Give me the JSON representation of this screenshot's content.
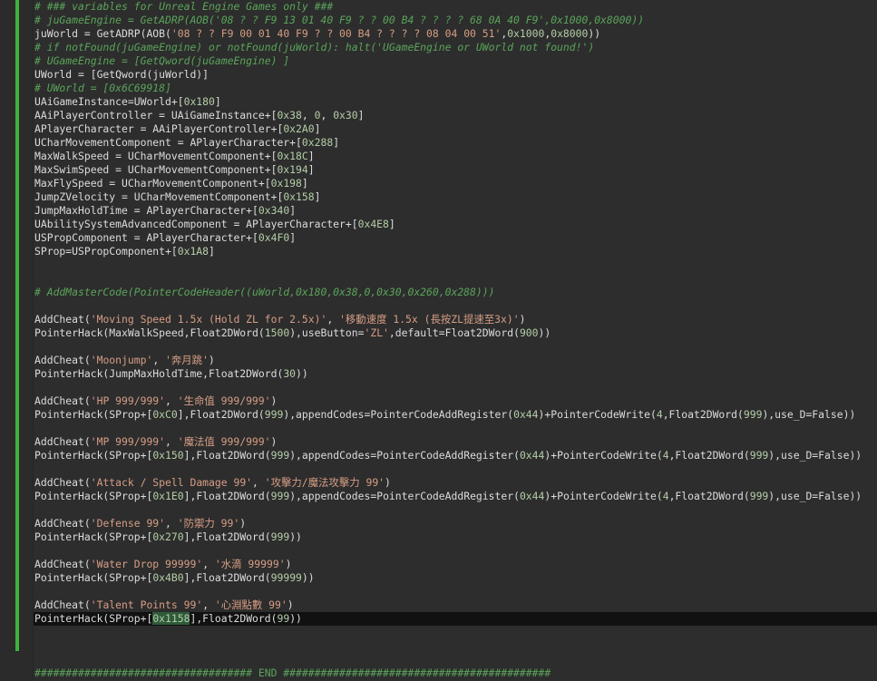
{
  "editor": {
    "colors": {
      "background": "#2d2d2d",
      "gutter": "#2b2b2b",
      "change_bar": "#3db33d",
      "current_line": "#111111",
      "comment": "#5aa45a",
      "string": "#d69d85",
      "number": "#b5cea8",
      "text": "#dcdcdc"
    },
    "current_line_index": 45,
    "lines": [
      [
        [
          "c",
          "# ### variables for Unreal Engine Games only ###"
        ]
      ],
      [
        [
          "c",
          "# juGameEngine = GetADRP(AOB('08 ? ? F9 13 01 40 F9 ? ? 00 B4 ? ? ? ? 68 0A 40 F9',0x1000,0x8000))"
        ]
      ],
      [
        [
          "t",
          "juWorld = GetADRP(AOB("
        ],
        [
          "s",
          "'08 ? ? F9 00 01 40 F9 ? ? 00 B4 ? ? ? ? 08 04 00 51'"
        ],
        [
          "t",
          ","
        ],
        [
          "n",
          "0x1000"
        ],
        [
          "t",
          ","
        ],
        [
          "n",
          "0x8000"
        ],
        [
          "t",
          "))"
        ]
      ],
      [
        [
          "c",
          "# if notFound(juGameEngine) or notFound(juWorld): halt('UGameEngine or UWorld not found!')"
        ]
      ],
      [
        [
          "c",
          "# UGameEngine = [GetQword(juGameEngine) ]"
        ]
      ],
      [
        [
          "t",
          "UWorld = [GetQword(juWorld)]"
        ]
      ],
      [
        [
          "c",
          "# UWorld = [0x6C69918]"
        ]
      ],
      [
        [
          "t",
          "UAiGameInstance=UWorld+["
        ],
        [
          "n",
          "0x180"
        ],
        [
          "t",
          "]"
        ]
      ],
      [
        [
          "t",
          "AAiPlayerController = UAiGameInstance+["
        ],
        [
          "n",
          "0x38"
        ],
        [
          "t",
          ", "
        ],
        [
          "n",
          "0"
        ],
        [
          "t",
          ", "
        ],
        [
          "n",
          "0x30"
        ],
        [
          "t",
          "]"
        ]
      ],
      [
        [
          "t",
          "APlayerCharacter = AAiPlayerController+["
        ],
        [
          "n",
          "0x2A0"
        ],
        [
          "t",
          "]"
        ]
      ],
      [
        [
          "t",
          "UCharMovementComponent = APlayerCharacter+["
        ],
        [
          "n",
          "0x288"
        ],
        [
          "t",
          "]"
        ]
      ],
      [
        [
          "t",
          "MaxWalkSpeed = UCharMovementComponent+["
        ],
        [
          "n",
          "0x18C"
        ],
        [
          "t",
          "]"
        ]
      ],
      [
        [
          "t",
          "MaxSwimSpeed = UCharMovementComponent+["
        ],
        [
          "n",
          "0x194"
        ],
        [
          "t",
          "]"
        ]
      ],
      [
        [
          "t",
          "MaxFlySpeed = UCharMovementComponent+["
        ],
        [
          "n",
          "0x198"
        ],
        [
          "t",
          "]"
        ]
      ],
      [
        [
          "t",
          "JumpZVelocity = UCharMovementComponent+["
        ],
        [
          "n",
          "0x158"
        ],
        [
          "t",
          "]"
        ]
      ],
      [
        [
          "t",
          "JumpMaxHoldTime = APlayerCharacter+["
        ],
        [
          "n",
          "0x340"
        ],
        [
          "t",
          "]"
        ]
      ],
      [
        [
          "t",
          "UAbilitySystemAdvancedComponent = APlayerCharacter+["
        ],
        [
          "n",
          "0x4E8"
        ],
        [
          "t",
          "]"
        ]
      ],
      [
        [
          "t",
          "USPropComponent = APlayerCharacter+["
        ],
        [
          "n",
          "0x4F0"
        ],
        [
          "t",
          "]"
        ]
      ],
      [
        [
          "t",
          "SProp=USPropComponent+["
        ],
        [
          "n",
          "0x1A8"
        ],
        [
          "t",
          "]"
        ]
      ],
      [],
      [],
      [
        [
          "c",
          "# AddMasterCode(PointerCodeHeader((uWorld,0x180,0x38,0,0x30,0x260,0x288)))"
        ]
      ],
      [],
      [
        [
          "t",
          "AddCheat("
        ],
        [
          "s",
          "'Moving Speed 1.5x (Hold ZL for 2.5x)'"
        ],
        [
          "t",
          ", "
        ],
        [
          "s",
          "'移動速度 1.5x (長按ZL提速至3x)'"
        ],
        [
          "t",
          ")"
        ]
      ],
      [
        [
          "t",
          "PointerHack(MaxWalkSpeed,Float2DWord("
        ],
        [
          "n",
          "1500"
        ],
        [
          "t",
          "),useButton="
        ],
        [
          "s",
          "'ZL'"
        ],
        [
          "t",
          ",default=Float2DWord("
        ],
        [
          "n",
          "900"
        ],
        [
          "t",
          "))"
        ]
      ],
      [],
      [
        [
          "t",
          "AddCheat("
        ],
        [
          "s",
          "'Moonjump'"
        ],
        [
          "t",
          ", "
        ],
        [
          "s",
          "'奔月跳'"
        ],
        [
          "t",
          ")"
        ]
      ],
      [
        [
          "t",
          "PointerHack(JumpMaxHoldTime,Float2DWord("
        ],
        [
          "n",
          "30"
        ],
        [
          "t",
          "))"
        ]
      ],
      [],
      [
        [
          "t",
          "AddCheat("
        ],
        [
          "s",
          "'HP 999/999'"
        ],
        [
          "t",
          ", "
        ],
        [
          "s",
          "'生命值 999/999'"
        ],
        [
          "t",
          ")"
        ]
      ],
      [
        [
          "t",
          "PointerHack(SProp+["
        ],
        [
          "n",
          "0xC0"
        ],
        [
          "t",
          "],Float2DWord("
        ],
        [
          "n",
          "999"
        ],
        [
          "t",
          "),appendCodes=PointerCodeAddRegister("
        ],
        [
          "n",
          "0x44"
        ],
        [
          "t",
          ")+PointerCodeWrite("
        ],
        [
          "n",
          "4"
        ],
        [
          "t",
          ",Float2DWord("
        ],
        [
          "n",
          "999"
        ],
        [
          "t",
          "),use_D=False))"
        ]
      ],
      [],
      [
        [
          "t",
          "AddCheat("
        ],
        [
          "s",
          "'MP 999/999'"
        ],
        [
          "t",
          ", "
        ],
        [
          "s",
          "'魔法值 999/999'"
        ],
        [
          "t",
          ")"
        ]
      ],
      [
        [
          "t",
          "PointerHack(SProp+["
        ],
        [
          "n",
          "0x150"
        ],
        [
          "t",
          "],Float2DWord("
        ],
        [
          "n",
          "999"
        ],
        [
          "t",
          "),appendCodes=PointerCodeAddRegister("
        ],
        [
          "n",
          "0x44"
        ],
        [
          "t",
          ")+PointerCodeWrite("
        ],
        [
          "n",
          "4"
        ],
        [
          "t",
          ",Float2DWord("
        ],
        [
          "n",
          "999"
        ],
        [
          "t",
          "),use_D=False))"
        ]
      ],
      [],
      [
        [
          "t",
          "AddCheat("
        ],
        [
          "s",
          "'Attack / Spell Damage 99'"
        ],
        [
          "t",
          ", "
        ],
        [
          "s",
          "'攻擊力/魔法攻擊力 99'"
        ],
        [
          "t",
          ")"
        ]
      ],
      [
        [
          "t",
          "PointerHack(SProp+["
        ],
        [
          "n",
          "0x1E0"
        ],
        [
          "t",
          "],Float2DWord("
        ],
        [
          "n",
          "999"
        ],
        [
          "t",
          "),appendCodes=PointerCodeAddRegister("
        ],
        [
          "n",
          "0x44"
        ],
        [
          "t",
          ")+PointerCodeWrite("
        ],
        [
          "n",
          "4"
        ],
        [
          "t",
          ",Float2DWord("
        ],
        [
          "n",
          "999"
        ],
        [
          "t",
          "),use_D=False))"
        ]
      ],
      [],
      [
        [
          "t",
          "AddCheat("
        ],
        [
          "s",
          "'Defense 99'"
        ],
        [
          "t",
          ", "
        ],
        [
          "s",
          "'防禦力 99'"
        ],
        [
          "t",
          ")"
        ]
      ],
      [
        [
          "t",
          "PointerHack(SProp+["
        ],
        [
          "n",
          "0x270"
        ],
        [
          "t",
          "],Float2DWord("
        ],
        [
          "n",
          "999"
        ],
        [
          "t",
          "))"
        ]
      ],
      [],
      [
        [
          "t",
          "AddCheat("
        ],
        [
          "s",
          "'Water Drop 99999'"
        ],
        [
          "t",
          ", "
        ],
        [
          "s",
          "'水滴 99999'"
        ],
        [
          "t",
          ")"
        ]
      ],
      [
        [
          "t",
          "PointerHack(SProp+["
        ],
        [
          "n",
          "0x4B0"
        ],
        [
          "t",
          "],Float2DWord("
        ],
        [
          "n",
          "99999"
        ],
        [
          "t",
          "))"
        ]
      ],
      [],
      [
        [
          "t",
          "AddCheat("
        ],
        [
          "s",
          "'Talent Points 99'"
        ],
        [
          "t",
          ", "
        ],
        [
          "s",
          "'心淵點數 99'"
        ],
        [
          "t",
          ")"
        ]
      ],
      [
        [
          "t",
          "PointerHack(SProp+"
        ],
        [
          "x",
          "["
        ],
        [
          "sel",
          "0x1158"
        ],
        [
          "x",
          "]"
        ],
        [
          "t",
          ",Float2DWord("
        ],
        [
          "n",
          "99"
        ],
        [
          "t",
          "))"
        ]
      ],
      [],
      [],
      [],
      [
        [
          "h",
          "################################### END ###########################################"
        ]
      ]
    ]
  }
}
